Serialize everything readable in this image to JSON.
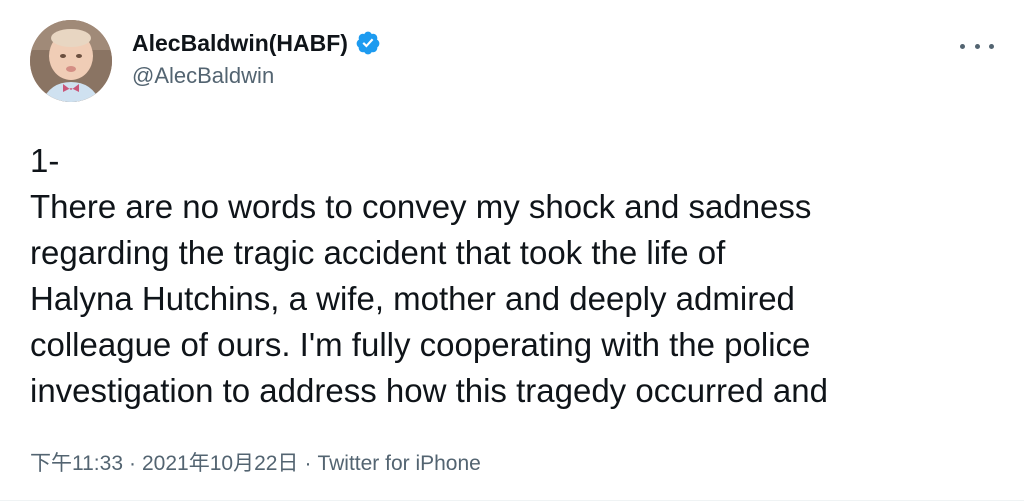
{
  "author": {
    "display_name": "AlecBaldwin(HABF)",
    "handle": "@AlecBaldwin",
    "verified": true,
    "verified_color": "#1d9bf0",
    "avatar": "avatar-photo"
  },
  "menu": {
    "icon": "more-horizontal-icon"
  },
  "tweet": {
    "lines": [
      "1-",
      "There are no words to convey my shock and sadness",
      "regarding the tragic accident that took the life of",
      "Halyna Hutchins, a wife, mother and deeply admired",
      "colleague of ours. I'm fully cooperating with the police",
      "investigation to address how this tragedy occurred and"
    ]
  },
  "meta": {
    "time": "下午11:33",
    "separator": "·",
    "date": "2021年10月22日",
    "source": "Twitter for iPhone"
  },
  "colors": {
    "text": "#0f1419",
    "secondary": "#536471",
    "background": "#ffffff"
  }
}
